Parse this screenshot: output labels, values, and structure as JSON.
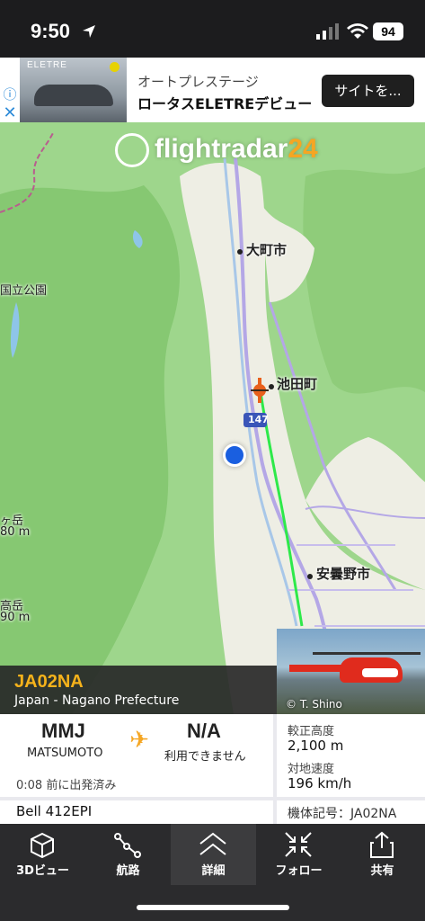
{
  "status_bar": {
    "time": "9:50",
    "battery": "94"
  },
  "ad": {
    "image_brand": "ELETRE",
    "title": "オートプレステージ",
    "subtitle": "ロータスELETREデビュー",
    "button": "サイトを..."
  },
  "map": {
    "logo_text": "flightradar",
    "logo_num": "24",
    "labels": {
      "omachi": "大町市",
      "ikeda": "池田町",
      "azumino": "安曇野市",
      "park": "国立公園",
      "peak1": "ヶ岳",
      "peak1_alt": "80 m",
      "peak2": "高岳",
      "peak2_alt": "90 m",
      "route": "147"
    },
    "photo_credit": "© T. Shino"
  },
  "aircraft": {
    "callsign": "JA02NA",
    "operator": "Japan - Nagano Prefecture",
    "origin_code": "MMJ",
    "origin_city": "MATSUMOTO",
    "dest_code": "N/A",
    "dest_city": "利用できません",
    "departed": "0:08 前に出発済み",
    "calibrated_alt_label": "較正高度",
    "calibrated_alt": "2,100 m",
    "ground_speed_label": "対地速度",
    "ground_speed": "196 km/h",
    "type": "Bell 412EPI",
    "registration": "機体記号：JA02NA"
  },
  "tabs": [
    {
      "label": "3Dビュー",
      "icon": "cube-icon"
    },
    {
      "label": "航路",
      "icon": "route-icon"
    },
    {
      "label": "詳細",
      "icon": "chevron-up-icon"
    },
    {
      "label": "フォロー",
      "icon": "follow-icon"
    },
    {
      "label": "共有",
      "icon": "share-icon"
    }
  ],
  "colors": {
    "callsign": "#f5b21b",
    "track": "#2ee94a",
    "map_green": "#9ed68c",
    "map_valley": "#eeeee4",
    "accent_orange": "#f5a623"
  }
}
